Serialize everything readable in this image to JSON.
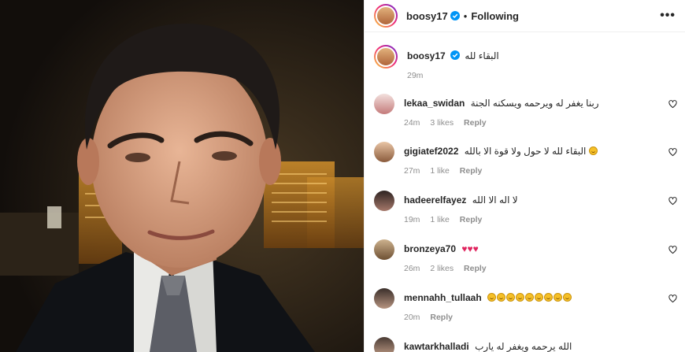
{
  "post": {
    "author": "boosy17",
    "separator": "•",
    "follow_state": "Following",
    "more_label": "•••",
    "caption_author": "boosy17",
    "caption_text": "البقاء لله",
    "caption_time": "29m"
  },
  "comments": [
    {
      "user": "lekaa_swidan",
      "text": "ربنا يغفر له ويرحمه ويسكنه الجنة",
      "time": "24m",
      "likes": "3 likes",
      "reply": "Reply"
    },
    {
      "user": "gigiatef2022",
      "text": "البقاء لله لا حول ولا قوة الا بالله",
      "time": "27m",
      "likes": "1 like",
      "reply": "Reply",
      "emoji_count": 1
    },
    {
      "user": "hadeerelfayez",
      "text": "لا اله الا الله",
      "time": "19m",
      "likes": "1 like",
      "reply": "Reply"
    },
    {
      "user": "bronzeya70",
      "text": "",
      "time": "26m",
      "likes": "2 likes",
      "reply": "Reply",
      "hearts": "♥♥♥"
    },
    {
      "user": "mennahh_tullaah",
      "text": "",
      "time": "20m",
      "likes": "",
      "reply": "Reply",
      "emoji_count": 9
    },
    {
      "user": "kawtarkhalladi",
      "text": "الله يرحمه ويغفر له يارب",
      "time": "",
      "likes": "",
      "reply": ""
    }
  ],
  "colors": {
    "accent": "#0095f6",
    "muted": "#8e8e8e",
    "border": "#efefef",
    "heart_red": "#e0245e"
  },
  "icons": {
    "verified": "verified-badge-icon",
    "like": "heart-outline-icon",
    "more": "more-options-icon"
  }
}
